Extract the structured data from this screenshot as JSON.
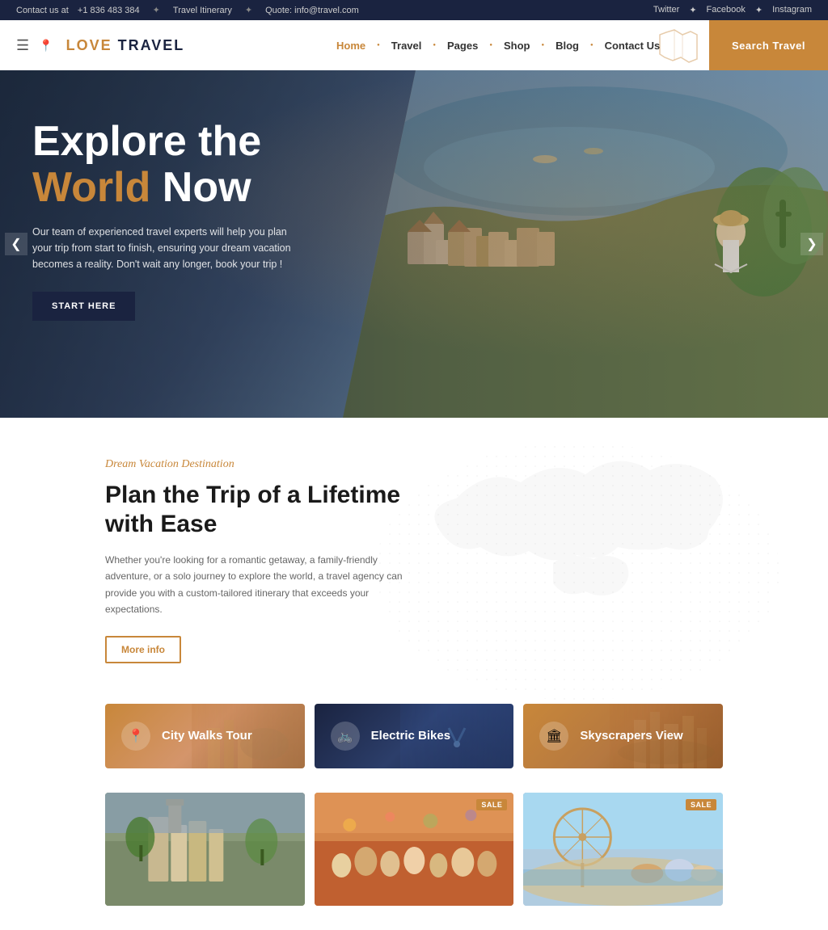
{
  "topbar": {
    "contact_label": "Contact us at",
    "phone": "+1 836 483 384",
    "itinerary": "Travel Itinerary",
    "quote": "Quote: info@travel.com",
    "social": [
      "Twitter",
      "Facebook",
      "Instagram"
    ]
  },
  "header": {
    "logo_text_part1": "Love",
    "logo_text_part2": "Travel",
    "nav_items": [
      {
        "label": "Home",
        "active": true
      },
      {
        "label": "Travel"
      },
      {
        "label": "Pages"
      },
      {
        "label": "Shop"
      },
      {
        "label": "Blog"
      },
      {
        "label": "Contact Us"
      }
    ],
    "search_btn": "Search Travel"
  },
  "hero": {
    "title_line1": "Explore the",
    "title_line2_highlight": "World",
    "title_line2_rest": " Now",
    "description": "Our team of experienced travel experts will help you plan your trip from start to finish, ensuring your dream vacation becomes a reality. Don't wait any longer, book your trip !",
    "cta_btn": "START HERE",
    "arrow_left": "❮",
    "arrow_right": "❯"
  },
  "section": {
    "subtitle": "Dream Vacation Destination",
    "title": "Plan the Trip of a Lifetime with Ease",
    "description": "Whether you're looking for a romantic getaway, a family-friendly adventure, or a solo journey to explore the world, a travel agency can provide you with a custom-tailored itinerary that exceeds your expectations.",
    "more_info_btn": "More info"
  },
  "tour_cards": [
    {
      "label": "City Walks Tour",
      "icon": "📍",
      "style": "warm"
    },
    {
      "label": "Electric Bikes",
      "icon": "🚲",
      "style": "dark"
    },
    {
      "label": "Skyscrapers View",
      "icon": "🏛",
      "style": "warm"
    }
  ],
  "product_cards": [
    {
      "has_sale": false
    },
    {
      "has_sale": true,
      "sale_label": "SALE"
    },
    {
      "has_sale": true,
      "sale_label": "SALE"
    }
  ]
}
